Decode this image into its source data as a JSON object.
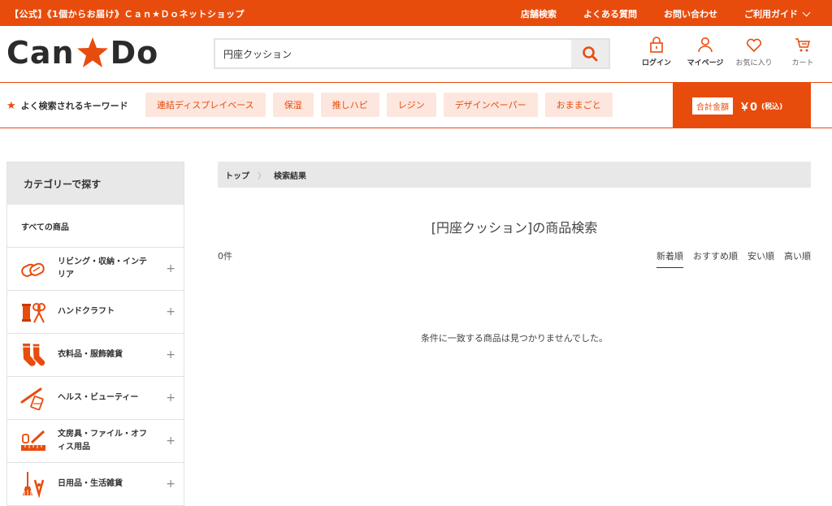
{
  "topbar": {
    "promo": "【公式】《1個からお届け》Ｃａｎ★Ｄｏネットショップ",
    "links": [
      "店舗検索",
      "よくある質問",
      "お問い合わせ",
      "ご利用ガイド"
    ]
  },
  "header": {
    "logo_left": "Can",
    "logo_right": "Do",
    "search_value": "円座クッション",
    "icons": [
      {
        "label": "ログイン",
        "icon": "lock-icon"
      },
      {
        "label": "マイページ",
        "icon": "person-icon"
      },
      {
        "label": "お気に入り",
        "icon": "heart-icon"
      },
      {
        "label": "カート",
        "icon": "cart-icon"
      }
    ]
  },
  "keywords": {
    "label": "よく検索されるキーワード",
    "items": [
      "連結ディスプレイベース",
      "保湿",
      "推しハピ",
      "レジン",
      "デザインペーパー",
      "おままごと"
    ]
  },
  "total": {
    "label": "合計金額",
    "amount": "￥0",
    "tax": "(税込)"
  },
  "sidebar": {
    "heading": "カテゴリーで探す",
    "all": "すべての商品",
    "items": [
      {
        "label": "リビング・収納・インテリア",
        "icon": "living-icon"
      },
      {
        "label": "ハンドクラフト",
        "icon": "handcraft-icon"
      },
      {
        "label": "衣料品・服飾雑貨",
        "icon": "socks-icon"
      },
      {
        "label": "ヘルス・ビューティー",
        "icon": "beauty-icon"
      },
      {
        "label": "文房具・ファイル・オフィス用品",
        "icon": "stationery-icon"
      },
      {
        "label": "日用品・生活雑貨",
        "icon": "household-icon"
      }
    ]
  },
  "main": {
    "breadcrumb": [
      "トップ",
      "検索結果"
    ],
    "title": "[円座クッション]の商品検索",
    "count": "0件",
    "sorts": [
      "新着順",
      "おすすめ順",
      "安い順",
      "高い順"
    ],
    "empty_message": "条件に一致する商品は見つかりませんでした。"
  },
  "colors": {
    "brand": "#e84c0d",
    "keyword_bg": "#fde6dd",
    "panel_bg": "#e8e8e8"
  }
}
